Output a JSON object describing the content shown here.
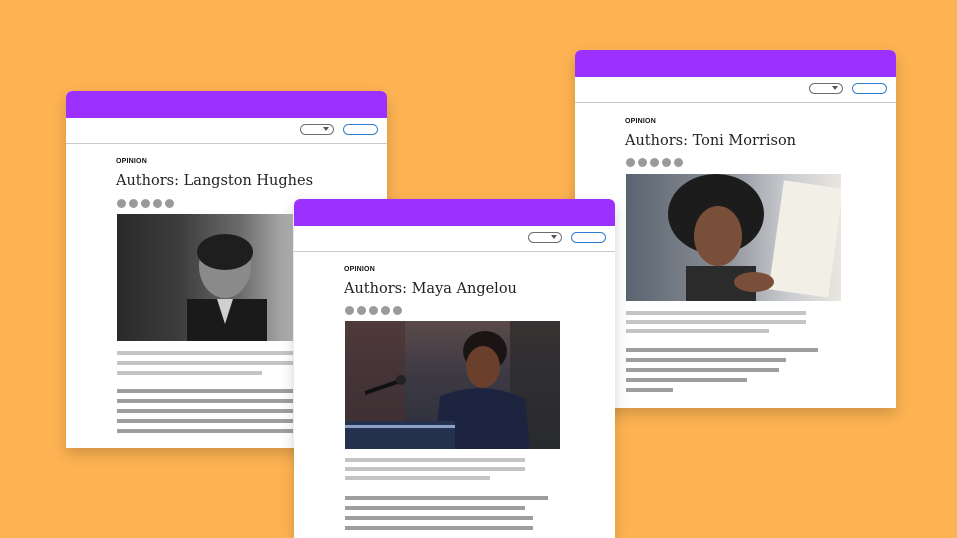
{
  "cards": [
    {
      "kicker": "OPINION",
      "headline": "Authors: Langston Hughes",
      "photo_subject": "portrait-photo",
      "colors": {
        "titlebar": "#9B30FF"
      }
    },
    {
      "kicker": "OPINION",
      "headline": "Authors: Toni Morrison",
      "photo_subject": "portrait-photo",
      "colors": {
        "titlebar": "#9B30FF"
      }
    },
    {
      "kicker": "OPINION",
      "headline": "Authors: Maya Angelou",
      "photo_subject": "speech-photo",
      "colors": {
        "titlebar": "#9B30FF"
      }
    }
  ],
  "colors": {
    "background": "#FDB352",
    "accent": "#9B30FF",
    "button_outline": "#2f7fd0"
  }
}
